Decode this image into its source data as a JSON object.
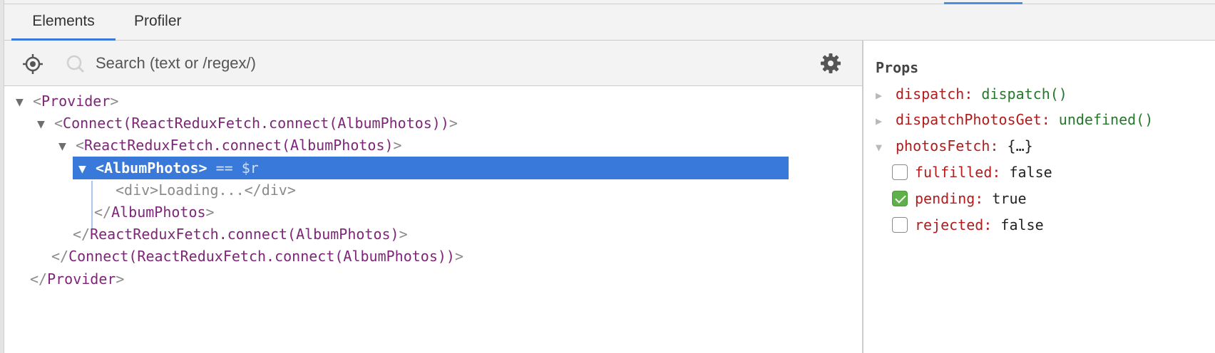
{
  "tabs": [
    {
      "label": "Elements",
      "active": true
    },
    {
      "label": "Profiler",
      "active": false
    }
  ],
  "toolbar": {
    "locate_icon": "crosshair-icon",
    "search_icon": "search-icon",
    "search_placeholder": "Search (text or /regex/)",
    "search_value": "",
    "settings_icon": "gear-icon"
  },
  "tree": [
    {
      "arrow": "▼",
      "open": "<",
      "name": "Provider",
      "close": ">"
    },
    {
      "arrow": "▼",
      "open": "<",
      "name": "Connect(ReactReduxFetch.connect(AlbumPhotos))",
      "close": ">"
    },
    {
      "arrow": "▼",
      "open": "<",
      "name": "ReactReduxFetch.connect(AlbumPhotos)",
      "close": ">"
    },
    {
      "arrow": "▼",
      "open": "<",
      "name": "AlbumPhotos",
      "close": ">",
      "suffix": " == $r",
      "selected": true
    },
    {
      "text": "<div>Loading...</div>"
    },
    {
      "open": "</",
      "name": "AlbumPhotos",
      "close": ">"
    },
    {
      "open": "</",
      "name": "ReactReduxFetch.connect(AlbumPhotos)",
      "close": ">"
    },
    {
      "open": "</",
      "name": "Connect(ReactReduxFetch.connect(AlbumPhotos))",
      "close": ">"
    },
    {
      "open": "</",
      "name": "Provider",
      "close": ">"
    }
  ],
  "props": {
    "title": "Props",
    "items": [
      {
        "arrow": "▶",
        "key": "dispatch:",
        "value": "dispatch()",
        "kind": "fn"
      },
      {
        "arrow": "▶",
        "key": "dispatchPhotosGet:",
        "value": "undefined()",
        "kind": "fn"
      },
      {
        "arrow": "▼",
        "key": "photosFetch:",
        "value": "{…}",
        "kind": "obj"
      }
    ],
    "children": [
      {
        "key": "fulfilled:",
        "value": "false",
        "checked": false
      },
      {
        "key": "pending:",
        "value": "true",
        "checked": true
      },
      {
        "key": "rejected:",
        "value": "false",
        "checked": false
      }
    ]
  },
  "colors": {
    "accent": "#3879d9",
    "tag": "#7d2577",
    "prop_key": "#b01c1c",
    "prop_fn": "#25772b",
    "checkbox_checked": "#5fb04a"
  }
}
